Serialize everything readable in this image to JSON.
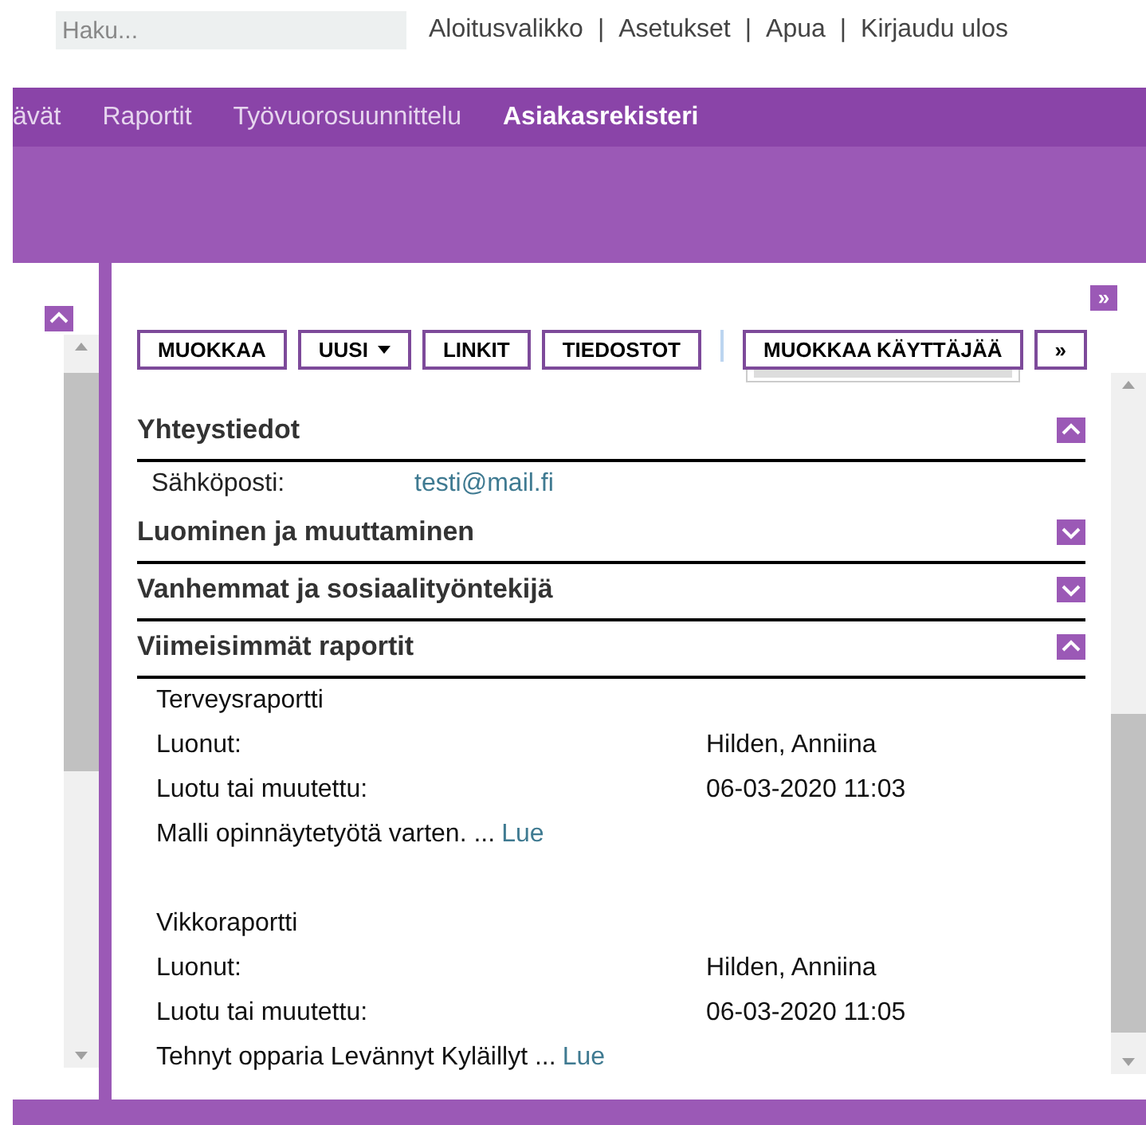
{
  "search": {
    "placeholder": "Haku..."
  },
  "top_links": [
    "Aloitusvalikko",
    "Asetukset",
    "Apua",
    "Kirjaudu ulos"
  ],
  "link_separator": "|",
  "nav": [
    {
      "label": "ävät",
      "selected": false
    },
    {
      "label": "Raportit",
      "selected": false
    },
    {
      "label": "Työvuorosuunnittelu",
      "selected": false
    },
    {
      "label": "Asiakasrekisteri",
      "selected": true
    }
  ],
  "expand_button": "»",
  "toolbar": [
    {
      "label": "MUOKKAA",
      "kind": "plain"
    },
    {
      "label": "UUSI",
      "kind": "dropdown"
    },
    {
      "label": "LINKIT",
      "kind": "plain"
    },
    {
      "label": "TIEDOSTOT",
      "kind": "plain"
    },
    {
      "label": "MUOKKAA KÄYTTÄJÄÄ",
      "kind": "plain"
    },
    {
      "label": "»",
      "kind": "plain"
    }
  ],
  "sections": [
    {
      "title": "Yhteystiedot",
      "expanded": true,
      "fields": [
        {
          "label": "Sähköposti:",
          "value": "testi@mail.fi"
        }
      ]
    },
    {
      "title": "Luominen ja muuttaminen",
      "expanded": false
    },
    {
      "title": "Vanhemmat ja sosiaalityöntekijä",
      "expanded": false
    },
    {
      "title": "Viimeisimmät raportit",
      "expanded": true,
      "reports": [
        {
          "name": "Terveysraportti",
          "rows": [
            {
              "label": "Luonut:",
              "value": "Hilden, Anniina"
            },
            {
              "label": "Luotu tai muutettu:",
              "value": "06-03-2020 11:03"
            }
          ],
          "summary": "Malli opinnäytetyötä varten. ...",
          "link": "Lue"
        },
        {
          "name": "Vikkoraportti",
          "rows": [
            {
              "label": "Luonut:",
              "value": "Hilden, Anniina"
            },
            {
              "label": "Luotu tai muutettu:",
              "value": "06-03-2020 11:05"
            }
          ],
          "summary": "Tehnyt opparia Levännyt Kyläillyt ...",
          "link": "Lue"
        }
      ]
    }
  ]
}
